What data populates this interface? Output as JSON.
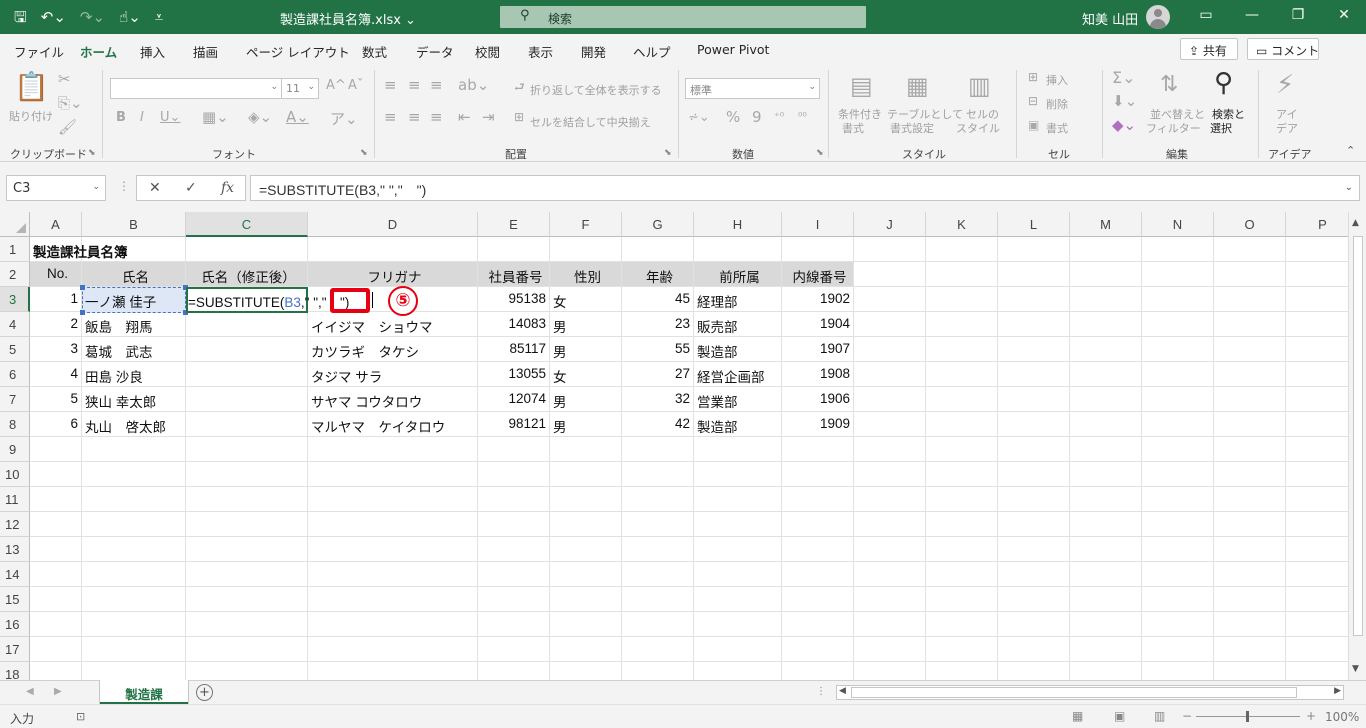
{
  "titlebar": {
    "doc_title": "製造課社員名簿.xlsx ⌄",
    "search_placeholder": "検索",
    "user_name": "知美 山田"
  },
  "tabs": [
    "ファイル",
    "ホーム",
    "挿入",
    "描画",
    "ページ レイアウト",
    "数式",
    "データ",
    "校閲",
    "表示",
    "開発",
    "ヘルプ",
    "Power Pivot"
  ],
  "active_tab": "ホーム",
  "share_label": "共有",
  "comment_label": "コメント",
  "ribbon": {
    "groups": [
      "クリップボード",
      "フォント",
      "配置",
      "数値",
      "スタイル",
      "セル",
      "編集",
      "アイデア"
    ],
    "paste": "貼り付け",
    "font_size": "11",
    "wrap_text": "折り返して全体を表示する",
    "merge_center": "セルを結合して中央揃え",
    "number_format": "標準",
    "cond_format": [
      "条件付き",
      "書式"
    ],
    "table_format": [
      "テーブルとして",
      "書式設定"
    ],
    "cell_style": [
      "セルの",
      "スタイル"
    ],
    "insert": "挿入",
    "delete": "削除",
    "format": "書式",
    "sort_filter": [
      "並べ替えと",
      "フィルター"
    ],
    "find_select": [
      "検索と",
      "選択"
    ],
    "ideas": [
      "アイ",
      "デア"
    ]
  },
  "formula_bar": {
    "name_box": "C3",
    "formula": "=SUBSTITUTE(B3,\" \",\"　\")"
  },
  "columns": [
    "A",
    "B",
    "C",
    "D",
    "E",
    "F",
    "G",
    "H",
    "I",
    "J",
    "K",
    "L",
    "M",
    "N",
    "O",
    "P"
  ],
  "rows": [
    "1",
    "2",
    "3",
    "4",
    "5",
    "6",
    "7",
    "8",
    "9",
    "10",
    "11",
    "12",
    "13",
    "14",
    "15",
    "16",
    "17",
    "18"
  ],
  "sheet": {
    "title": "製造課社員名簿",
    "headers": [
      "No.",
      "氏名",
      "氏名（修正後）",
      "フリガナ",
      "社員番号",
      "性別",
      "年齢",
      "前所属",
      "内線番号"
    ],
    "records": [
      {
        "no": "1",
        "name": "一ノ瀬 佳子",
        "kana": "",
        "emp": "95138",
        "sex": "女",
        "age": "45",
        "dept": "経理部",
        "ext": "1902"
      },
      {
        "no": "2",
        "name": "飯島　翔馬",
        "kana": "イイジマ　ショウマ",
        "emp": "14083",
        "sex": "男",
        "age": "23",
        "dept": "販売部",
        "ext": "1904"
      },
      {
        "no": "3",
        "name": "葛城　武志",
        "kana": "カツラギ　タケシ",
        "emp": "85117",
        "sex": "男",
        "age": "55",
        "dept": "製造部",
        "ext": "1907"
      },
      {
        "no": "4",
        "name": "田島 沙良",
        "kana": "タジマ サラ",
        "emp": "13055",
        "sex": "女",
        "age": "27",
        "dept": "経営企画部",
        "ext": "1908"
      },
      {
        "no": "5",
        "name": "狭山 幸太郎",
        "kana": "サヤマ コウタロウ",
        "emp": "12074",
        "sex": "男",
        "age": "32",
        "dept": "営業部",
        "ext": "1906"
      },
      {
        "no": "6",
        "name": "丸山　啓太郎",
        "kana": "マルヤマ　ケイタロウ",
        "emp": "98121",
        "sex": "男",
        "age": "42",
        "dept": "製造部",
        "ext": "1909"
      }
    ],
    "editing": {
      "prefix": "=SUBSTITUTE(",
      "ref": "B3",
      "suffix": ",\" \",\"　\")"
    },
    "step_badge": "⑤"
  },
  "sheet_tab": "製造課",
  "status": {
    "mode": "入力",
    "zoom": "100%"
  },
  "colors": {
    "accent": "#217346",
    "highlight": "#e60012",
    "ref": "#4472c4"
  }
}
